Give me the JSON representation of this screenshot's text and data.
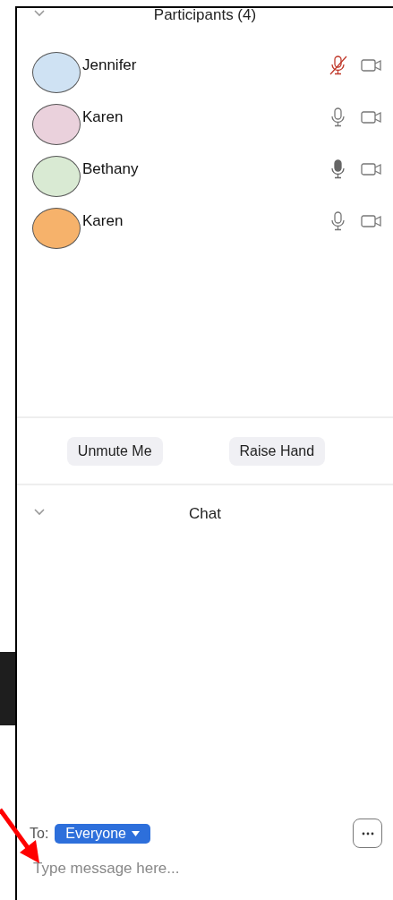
{
  "participants_panel": {
    "title": "Participants (4)",
    "expanded": true,
    "participants": [
      {
        "name": "Jennifer",
        "color": "#cfe2f3",
        "muted": true,
        "speaking": false
      },
      {
        "name": "Karen",
        "color": "#ead1dc",
        "muted": false,
        "speaking": false
      },
      {
        "name": "Bethany",
        "color": "#d9ead3",
        "muted": false,
        "speaking": true
      },
      {
        "name": "Karen",
        "color": "#f6b26b",
        "muted": false,
        "speaking": false
      }
    ],
    "buttons": [
      "Unmute Me",
      "Raise Hand"
    ]
  },
  "chat_panel": {
    "title": "Chat",
    "expanded": true,
    "to_label": "To:",
    "recipient": "Everyone",
    "message": {
      "placeholder": "Type message here..."
    }
  }
}
